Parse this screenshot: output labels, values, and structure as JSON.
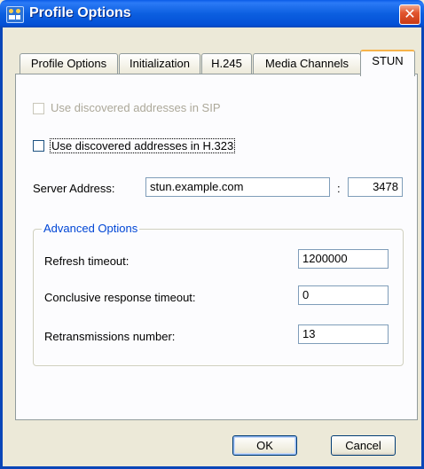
{
  "window": {
    "title": "Profile Options",
    "close_glyph": "✕"
  },
  "tabs": [
    "Profile Options",
    "Initialization",
    "H.245",
    "Media Channels",
    "STUN"
  ],
  "active_tab": "STUN",
  "stun": {
    "sip_checkbox_label": "Use discovered addresses in SIP",
    "sip_checked": false,
    "sip_enabled": false,
    "h323_checkbox_label": "Use discovered addresses in H.323",
    "h323_checked": false,
    "server_address_label": "Server Address:",
    "server_address_value": "stun.example.com",
    "port_separator": ":",
    "port_value": "3478"
  },
  "advanced": {
    "title": "Advanced Options",
    "refresh_label": "Refresh timeout:",
    "refresh_value": "1200000",
    "conclusive_label": "Conclusive response timeout:",
    "conclusive_value": "0",
    "retrans_label": "Retransmissions number:",
    "retrans_value": "13"
  },
  "buttons": {
    "ok": "OK",
    "cancel": "Cancel"
  },
  "colors": {
    "titlebar": "#0a5be8",
    "active_tab_accent": "#f7b34a",
    "group_title": "#0046d5",
    "close": "#e2562f"
  }
}
